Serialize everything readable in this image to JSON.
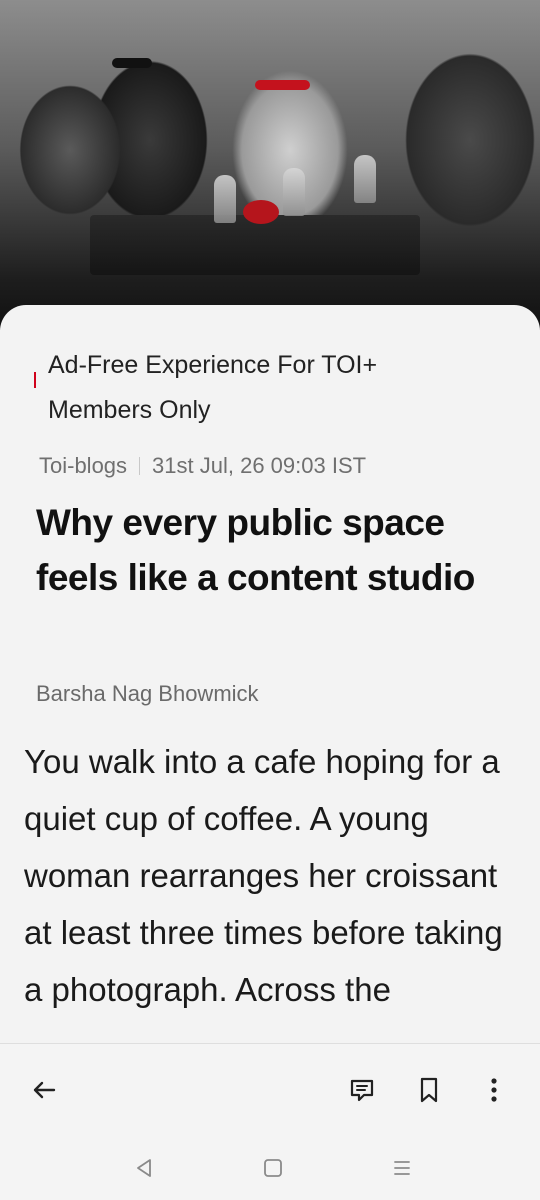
{
  "hero": {
    "alt_icon": "photo-of-people-at-cafe"
  },
  "banner": {
    "ad_text": "Ad-Free Experience For TOI+ Members Only",
    "accent_color": "#d0021b"
  },
  "article": {
    "category": "Toi-blogs",
    "date": "31st Jul, 26 09:03  IST",
    "headline": "Why every public space feels like a content studio",
    "author": "Barsha Nag Bhowmick",
    "body": "You walk into a cafe hoping for a quiet cup of coffee. A young woman rearranges her croissant at least three times before taking a photograph. Across the"
  },
  "toolbar": {
    "back_icon": "arrow-left-icon",
    "comment_icon": "comment-icon",
    "bookmark_icon": "bookmark-icon",
    "more_icon": "more-vertical-icon"
  },
  "system_nav": {
    "back": "triangle-back-icon",
    "home": "square-home-icon",
    "recents": "menu-lines-icon"
  }
}
